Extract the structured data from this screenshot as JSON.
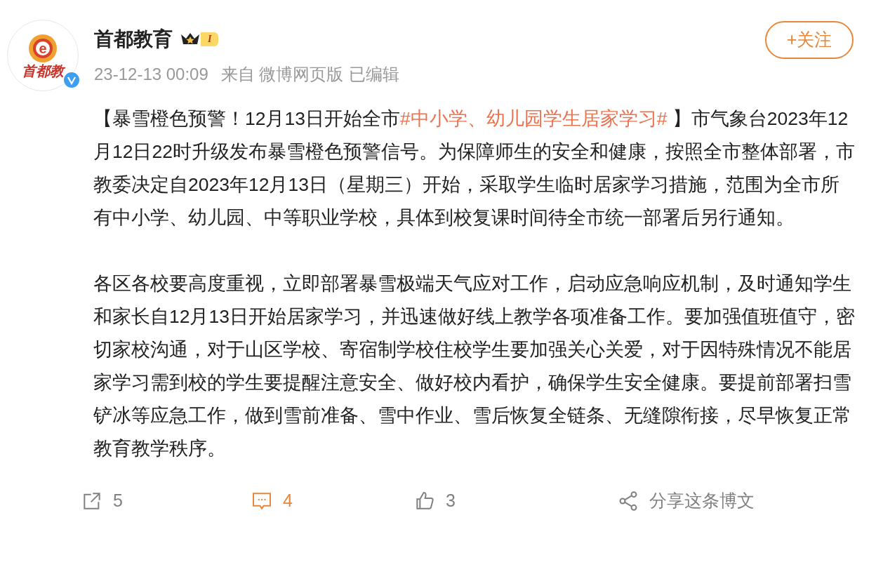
{
  "author": {
    "name": "首都教育",
    "avatar": {
      "logo_letter": "e",
      "logo_text": "首都教",
      "verified": true
    },
    "level_badge": "I",
    "time": "23-12-13 00:09",
    "source": "来自 微博网页版",
    "edited": "已编辑"
  },
  "follow_button": {
    "label": "+关注",
    "following": false
  },
  "paragraphs": [
    [
      {
        "kind": "text",
        "text": "【暴雪橙色预警！12月13日开始全市"
      },
      {
        "kind": "hashtag",
        "text": "#中小学、幼儿园学生居家学习#"
      },
      {
        "kind": "text",
        "text": " 】市气象台2023年12月12日22时升级发布暴雪橙色预警信号。为保障师生的安全和健康，按照全市整体部署，市教委决定自2023年12月13日（星期三）开始，采取学生临时居家学习措施，范围为全市所有中小学、幼儿园、中等职业学校，具体到校复课时间待全市统一部署后另行通知。"
      }
    ],
    [
      {
        "kind": "text",
        "text": "各区各校要高度重视，立即部署暴雪极端天气应对工作，启动应急响应机制，及时通知学生和家长自12月13日开始居家学习，并迅速做好线上教学各项准备工作。要加强值班值守，密切家校沟通，对于山区学校、寄宿制学校住校学生要加强关心关爱，对于因特殊情况不能居家学习需到校的学生要提醒注意安全、做好校内看护，确保学生安全健康。要提前部署扫雪铲冰等应急工作，做到雪前准备、雪中作业、雪后恢复全链条、无缝隙衔接，尽早恢复正常教育教学秩序。"
      }
    ]
  ],
  "actions": [
    {
      "kind": "repost",
      "count": "5",
      "selected": false
    },
    {
      "kind": "comment",
      "count": "4",
      "selected": true
    },
    {
      "kind": "like",
      "count": "3",
      "selected": false
    },
    {
      "kind": "share",
      "label": "分享这条博文",
      "selected": false
    }
  ]
}
